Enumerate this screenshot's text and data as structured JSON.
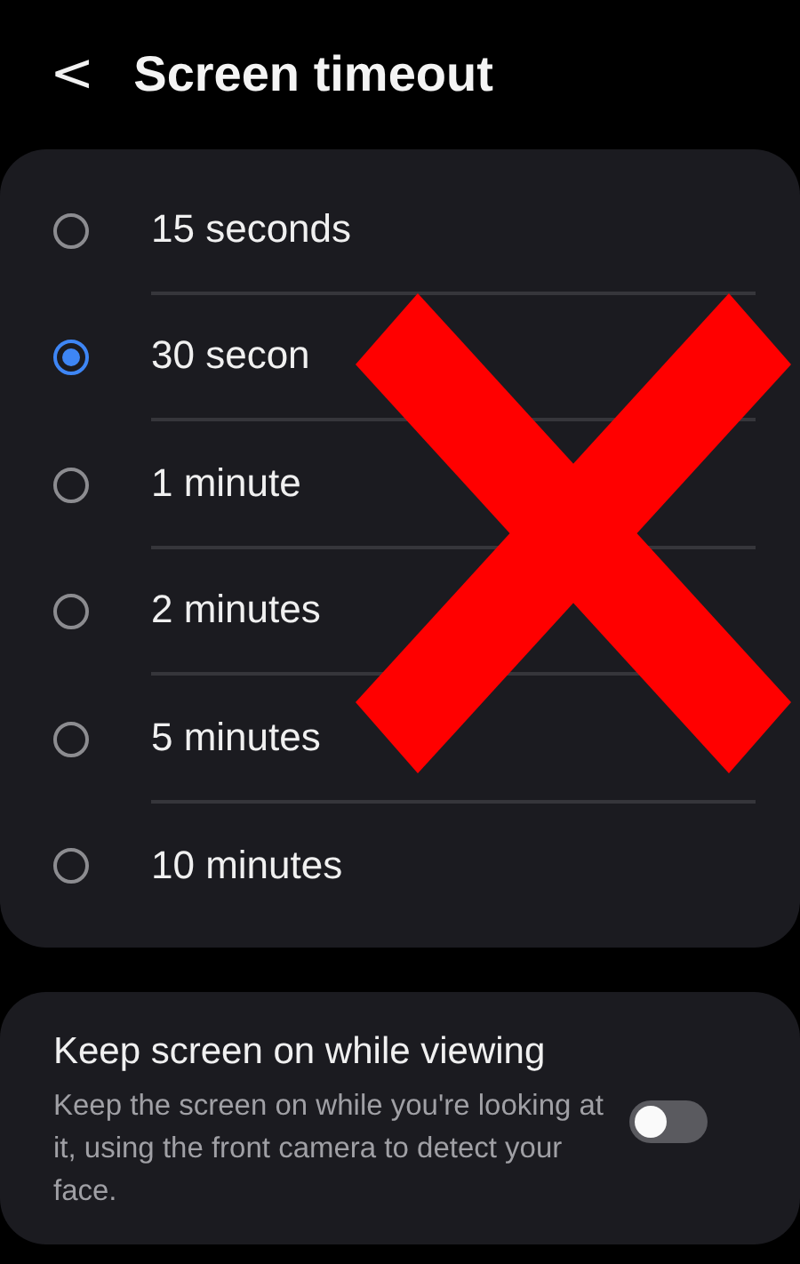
{
  "header": {
    "back": "<",
    "title": "Screen timeout"
  },
  "options": [
    {
      "label": "15 seconds",
      "selected": false
    },
    {
      "label": "30 secon",
      "selected": true
    },
    {
      "label": "1 minute",
      "selected": false
    },
    {
      "label": "2 minutes",
      "selected": false
    },
    {
      "label": "5 minutes",
      "selected": false
    },
    {
      "label": "10 minutes",
      "selected": false
    }
  ],
  "keep_screen_on": {
    "title": "Keep screen on while viewing",
    "description": "Keep the screen on while you're looking at it, using the front camera to detect your face.",
    "on": false
  }
}
